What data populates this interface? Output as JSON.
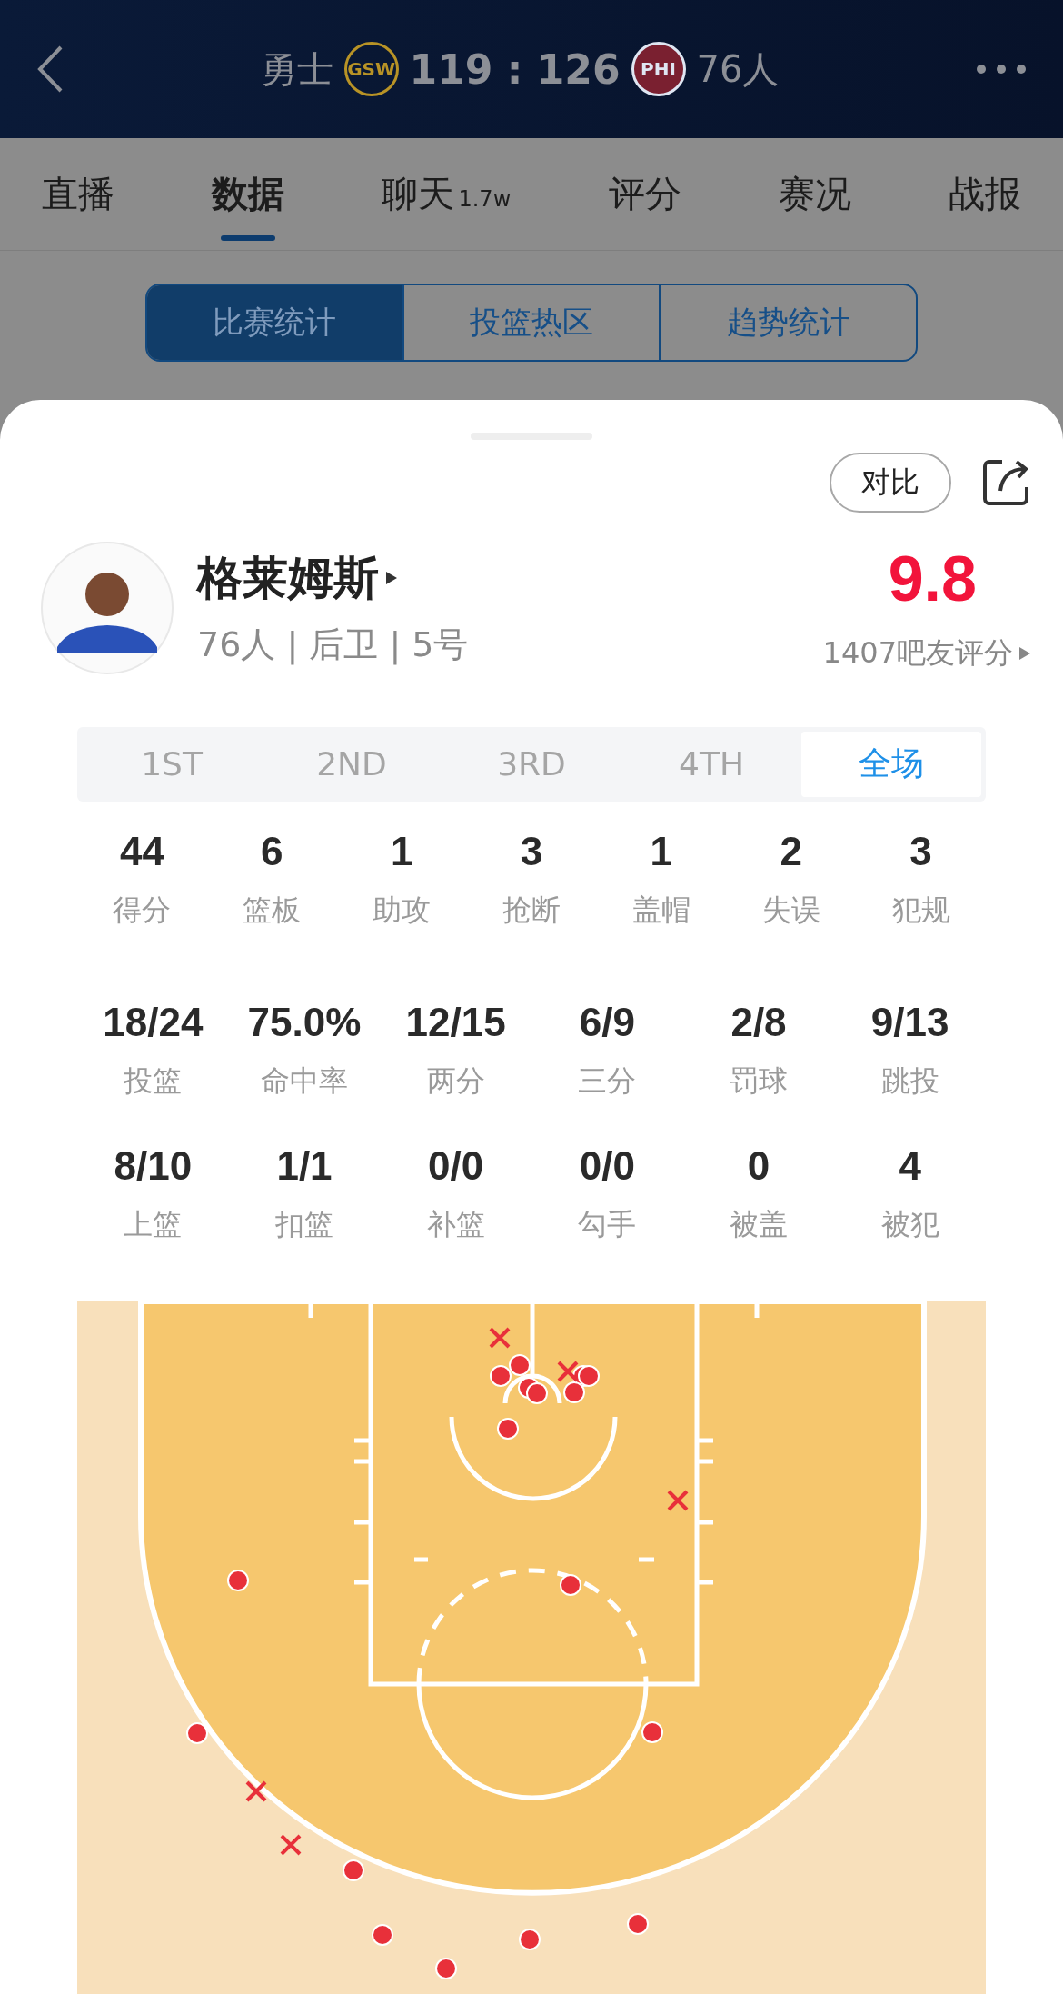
{
  "header": {
    "home_team": "勇士",
    "home_logo": "GSW",
    "score": "119 : 126",
    "away_logo": "PHI",
    "away_team": "76人"
  },
  "tabs": [
    {
      "label": "直播",
      "selected": false
    },
    {
      "label": "数据",
      "selected": true
    },
    {
      "label": "聊天",
      "badge": "1.7w",
      "selected": false
    },
    {
      "label": "评分",
      "selected": false
    },
    {
      "label": "赛况",
      "selected": false
    },
    {
      "label": "战报",
      "selected": false
    }
  ],
  "segments": [
    {
      "label": "比赛统计",
      "selected": true
    },
    {
      "label": "投篮热区",
      "selected": false
    },
    {
      "label": "趋势统计",
      "selected": false
    }
  ],
  "sheet": {
    "compare_button": "对比",
    "player": {
      "name": "格莱姆斯",
      "info": "76人 | 后卫 | 5号"
    },
    "rating": "9.8",
    "rating_link": "1407吧友评分",
    "periods": [
      {
        "label": "1ST",
        "selected": false
      },
      {
        "label": "2ND",
        "selected": false
      },
      {
        "label": "3RD",
        "selected": false
      },
      {
        "label": "4TH",
        "selected": false
      },
      {
        "label": "全场",
        "selected": true
      }
    ],
    "stat_rows": [
      [
        {
          "value": "44",
          "label": "得分"
        },
        {
          "value": "6",
          "label": "篮板"
        },
        {
          "value": "1",
          "label": "助攻"
        },
        {
          "value": "3",
          "label": "抢断"
        },
        {
          "value": "1",
          "label": "盖帽"
        },
        {
          "value": "2",
          "label": "失误"
        },
        {
          "value": "3",
          "label": "犯规"
        }
      ],
      [
        {
          "value": "18/24",
          "label": "投篮"
        },
        {
          "value": "75.0%",
          "label": "命中率"
        },
        {
          "value": "12/15",
          "label": "两分"
        },
        {
          "value": "6/9",
          "label": "三分"
        },
        {
          "value": "2/8",
          "label": "罚球"
        },
        {
          "value": "9/13",
          "label": "跳投"
        }
      ],
      [
        {
          "value": "8/10",
          "label": "上篮"
        },
        {
          "value": "1/1",
          "label": "扣篮"
        },
        {
          "value": "0/0",
          "label": "补篮"
        },
        {
          "value": "0/0",
          "label": "勾手"
        },
        {
          "value": "0",
          "label": "被盖"
        },
        {
          "value": "4",
          "label": "被犯"
        }
      ]
    ],
    "shots": [
      {
        "made": true
      },
      {
        "made": true
      },
      {
        "made": true
      },
      {
        "made": true
      },
      {
        "made": true
      },
      {
        "made": true
      },
      {
        "made": true
      },
      {
        "made": true
      },
      {
        "made": true
      },
      {
        "made": true
      },
      {
        "made": true
      },
      {
        "made": true
      },
      {
        "made": true
      },
      {
        "made": true
      },
      {
        "made": true
      },
      {
        "made": true
      },
      {
        "made": true
      },
      {
        "made": false
      },
      {
        "made": false
      },
      {
        "made": false
      },
      {
        "made": false
      },
      {
        "made": false
      }
    ]
  }
}
